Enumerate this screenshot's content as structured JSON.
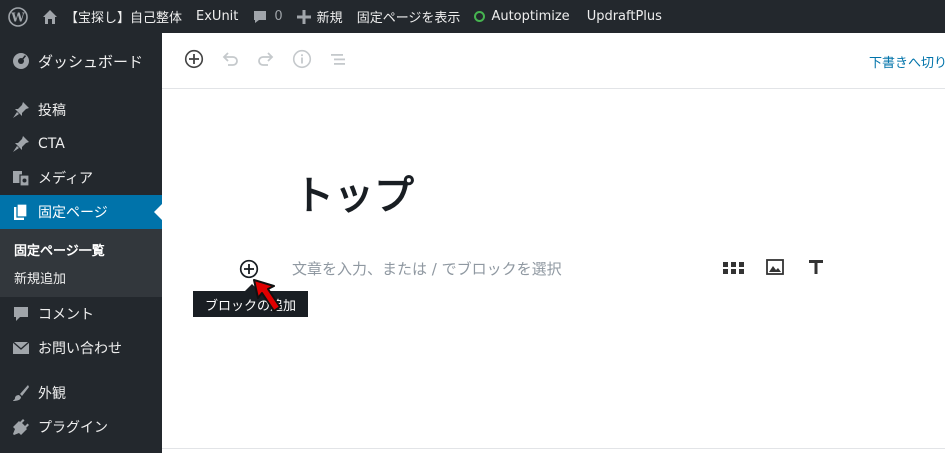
{
  "adminbar": {
    "site_name": "【宝探し】自己整体",
    "exunit": "ExUnit",
    "comments_count": "0",
    "new_label": "新規",
    "view_page": "固定ページを表示",
    "autoptimize": "Autoptimize",
    "updraftplus": "UpdraftPlus"
  },
  "sidebar": {
    "items": [
      {
        "label": "ダッシュボード",
        "icon": "dashboard-icon"
      },
      {
        "label": "投稿",
        "icon": "pin-icon"
      },
      {
        "label": "CTA",
        "icon": "pin-icon"
      },
      {
        "label": "メディア",
        "icon": "media-icon"
      },
      {
        "label": "固定ページ",
        "icon": "pages-icon"
      },
      {
        "label": "コメント",
        "icon": "comment-icon"
      },
      {
        "label": "お問い合わせ",
        "icon": "mail-icon"
      },
      {
        "label": "外観",
        "icon": "brush-icon"
      },
      {
        "label": "プラグイン",
        "icon": "plugin-icon"
      }
    ],
    "submenu": [
      {
        "label": "固定ページ一覧"
      },
      {
        "label": "新規追加"
      }
    ]
  },
  "editor": {
    "draft_link": "下書きへ切り",
    "title": "トップ",
    "placeholder": "文章を入力、または / でブロックを選択",
    "tooltip": "ブロックの追加"
  },
  "colors": {
    "admin_bg": "#23282d",
    "accent": "#0073aa",
    "submenu_bg": "#32373c",
    "cursor_red": "#e00000"
  }
}
